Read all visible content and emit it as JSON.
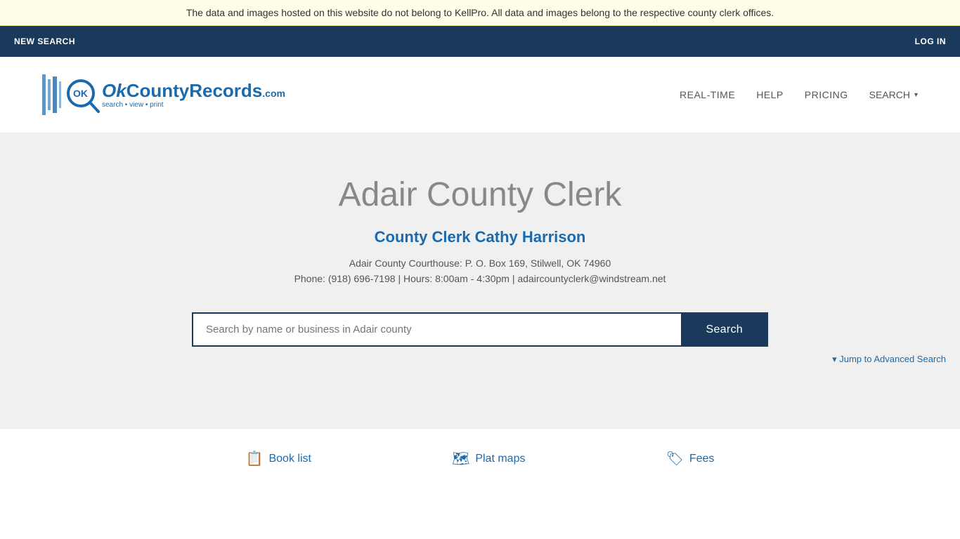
{
  "banner": {
    "text": "The data and images hosted on this website do not belong to KellPro. All data and images belong to the respective county clerk offices."
  },
  "topNav": {
    "newSearch": "NEW SEARCH",
    "logIn": "LOG IN"
  },
  "header": {
    "logoAlt": "OKCountyRecords.com",
    "logoTagline": "search • view • print",
    "nav": {
      "realtime": "REAL-TIME",
      "help": "HELP",
      "pricing": "PRICING",
      "search": "SEARCH"
    }
  },
  "main": {
    "countyTitle": "Adair County Clerk",
    "clerkName": "County Clerk Cathy Harrison",
    "address": "Adair County Courthouse: P. O. Box 169, Stilwell, OK 74960",
    "phone": "Phone: (918) 696-7198 | Hours: 8:00am - 4:30pm | adaircountyclerk@windstream.net",
    "searchPlaceholder": "Search by name or business in Adair county",
    "searchButton": "Search",
    "advancedSearchText": "▾ Jump to Advanced Search"
  },
  "footer": {
    "links": [
      {
        "icon": "📋",
        "label": "Book list"
      },
      {
        "icon": "🗺",
        "label": "Plat maps"
      },
      {
        "icon": "🏷",
        "label": "Fees"
      }
    ]
  }
}
